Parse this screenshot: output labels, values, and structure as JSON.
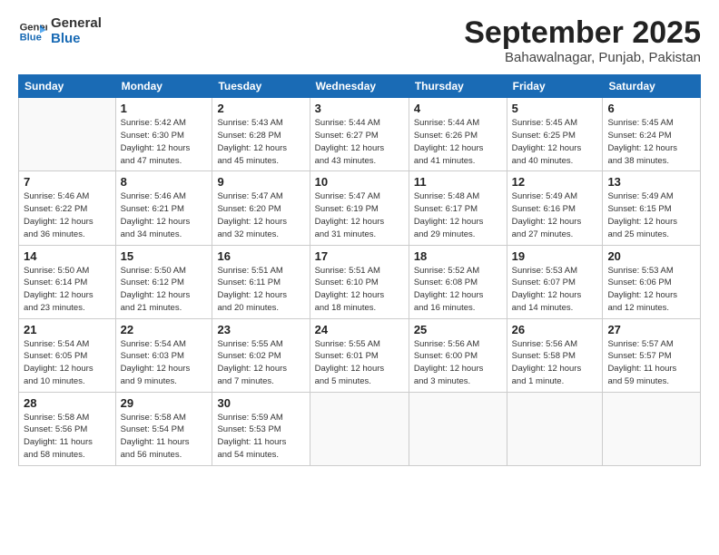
{
  "logo": {
    "line1": "General",
    "line2": "Blue"
  },
  "header": {
    "month": "September 2025",
    "location": "Bahawalnagar, Punjab, Pakistan"
  },
  "days_of_week": [
    "Sunday",
    "Monday",
    "Tuesday",
    "Wednesday",
    "Thursday",
    "Friday",
    "Saturday"
  ],
  "weeks": [
    [
      {
        "day": "",
        "info": ""
      },
      {
        "day": "1",
        "info": "Sunrise: 5:42 AM\nSunset: 6:30 PM\nDaylight: 12 hours\nand 47 minutes."
      },
      {
        "day": "2",
        "info": "Sunrise: 5:43 AM\nSunset: 6:28 PM\nDaylight: 12 hours\nand 45 minutes."
      },
      {
        "day": "3",
        "info": "Sunrise: 5:44 AM\nSunset: 6:27 PM\nDaylight: 12 hours\nand 43 minutes."
      },
      {
        "day": "4",
        "info": "Sunrise: 5:44 AM\nSunset: 6:26 PM\nDaylight: 12 hours\nand 41 minutes."
      },
      {
        "day": "5",
        "info": "Sunrise: 5:45 AM\nSunset: 6:25 PM\nDaylight: 12 hours\nand 40 minutes."
      },
      {
        "day": "6",
        "info": "Sunrise: 5:45 AM\nSunset: 6:24 PM\nDaylight: 12 hours\nand 38 minutes."
      }
    ],
    [
      {
        "day": "7",
        "info": "Sunrise: 5:46 AM\nSunset: 6:22 PM\nDaylight: 12 hours\nand 36 minutes."
      },
      {
        "day": "8",
        "info": "Sunrise: 5:46 AM\nSunset: 6:21 PM\nDaylight: 12 hours\nand 34 minutes."
      },
      {
        "day": "9",
        "info": "Sunrise: 5:47 AM\nSunset: 6:20 PM\nDaylight: 12 hours\nand 32 minutes."
      },
      {
        "day": "10",
        "info": "Sunrise: 5:47 AM\nSunset: 6:19 PM\nDaylight: 12 hours\nand 31 minutes."
      },
      {
        "day": "11",
        "info": "Sunrise: 5:48 AM\nSunset: 6:17 PM\nDaylight: 12 hours\nand 29 minutes."
      },
      {
        "day": "12",
        "info": "Sunrise: 5:49 AM\nSunset: 6:16 PM\nDaylight: 12 hours\nand 27 minutes."
      },
      {
        "day": "13",
        "info": "Sunrise: 5:49 AM\nSunset: 6:15 PM\nDaylight: 12 hours\nand 25 minutes."
      }
    ],
    [
      {
        "day": "14",
        "info": "Sunrise: 5:50 AM\nSunset: 6:14 PM\nDaylight: 12 hours\nand 23 minutes."
      },
      {
        "day": "15",
        "info": "Sunrise: 5:50 AM\nSunset: 6:12 PM\nDaylight: 12 hours\nand 21 minutes."
      },
      {
        "day": "16",
        "info": "Sunrise: 5:51 AM\nSunset: 6:11 PM\nDaylight: 12 hours\nand 20 minutes."
      },
      {
        "day": "17",
        "info": "Sunrise: 5:51 AM\nSunset: 6:10 PM\nDaylight: 12 hours\nand 18 minutes."
      },
      {
        "day": "18",
        "info": "Sunrise: 5:52 AM\nSunset: 6:08 PM\nDaylight: 12 hours\nand 16 minutes."
      },
      {
        "day": "19",
        "info": "Sunrise: 5:53 AM\nSunset: 6:07 PM\nDaylight: 12 hours\nand 14 minutes."
      },
      {
        "day": "20",
        "info": "Sunrise: 5:53 AM\nSunset: 6:06 PM\nDaylight: 12 hours\nand 12 minutes."
      }
    ],
    [
      {
        "day": "21",
        "info": "Sunrise: 5:54 AM\nSunset: 6:05 PM\nDaylight: 12 hours\nand 10 minutes."
      },
      {
        "day": "22",
        "info": "Sunrise: 5:54 AM\nSunset: 6:03 PM\nDaylight: 12 hours\nand 9 minutes."
      },
      {
        "day": "23",
        "info": "Sunrise: 5:55 AM\nSunset: 6:02 PM\nDaylight: 12 hours\nand 7 minutes."
      },
      {
        "day": "24",
        "info": "Sunrise: 5:55 AM\nSunset: 6:01 PM\nDaylight: 12 hours\nand 5 minutes."
      },
      {
        "day": "25",
        "info": "Sunrise: 5:56 AM\nSunset: 6:00 PM\nDaylight: 12 hours\nand 3 minutes."
      },
      {
        "day": "26",
        "info": "Sunrise: 5:56 AM\nSunset: 5:58 PM\nDaylight: 12 hours\nand 1 minute."
      },
      {
        "day": "27",
        "info": "Sunrise: 5:57 AM\nSunset: 5:57 PM\nDaylight: 11 hours\nand 59 minutes."
      }
    ],
    [
      {
        "day": "28",
        "info": "Sunrise: 5:58 AM\nSunset: 5:56 PM\nDaylight: 11 hours\nand 58 minutes."
      },
      {
        "day": "29",
        "info": "Sunrise: 5:58 AM\nSunset: 5:54 PM\nDaylight: 11 hours\nand 56 minutes."
      },
      {
        "day": "30",
        "info": "Sunrise: 5:59 AM\nSunset: 5:53 PM\nDaylight: 11 hours\nand 54 minutes."
      },
      {
        "day": "",
        "info": ""
      },
      {
        "day": "",
        "info": ""
      },
      {
        "day": "",
        "info": ""
      },
      {
        "day": "",
        "info": ""
      }
    ]
  ]
}
